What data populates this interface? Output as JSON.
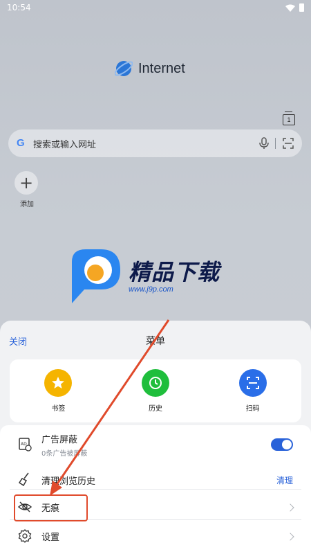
{
  "status_bar": {
    "time": "10:54"
  },
  "brand": {
    "title": "Internet"
  },
  "tabs": {
    "count": "1"
  },
  "search": {
    "placeholder": "搜索或输入网址",
    "google_glyph": "G"
  },
  "shortcuts": {
    "add_label": "添加",
    "add_glyph": "+"
  },
  "watermark": {
    "text": "精品下载",
    "url": "www.j9p.com"
  },
  "menu": {
    "close_label": "关闭",
    "title": "菜单",
    "quick_actions": [
      {
        "label": "书签",
        "icon": "star-icon",
        "color": "#f5b400"
      },
      {
        "label": "历史",
        "icon": "clock-icon",
        "color": "#1fbe3c"
      },
      {
        "label": "扫码",
        "icon": "scan-icon",
        "color": "#2a6ee8"
      }
    ],
    "items": [
      {
        "title": "广告屏蔽",
        "subtitle": "0条广告被屏蔽",
        "icon": "ad-block-icon",
        "control": "toggle",
        "toggle_on": true
      },
      {
        "title": "清理浏览历史",
        "icon": "broom-icon",
        "action_label": "清理"
      },
      {
        "title": "无痕",
        "icon": "eye-off-icon",
        "control": "chevron"
      },
      {
        "title": "设置",
        "icon": "gear-icon",
        "control": "chevron"
      }
    ]
  },
  "colors": {
    "accent": "#2962d9",
    "annotation": "#e04a2b"
  }
}
